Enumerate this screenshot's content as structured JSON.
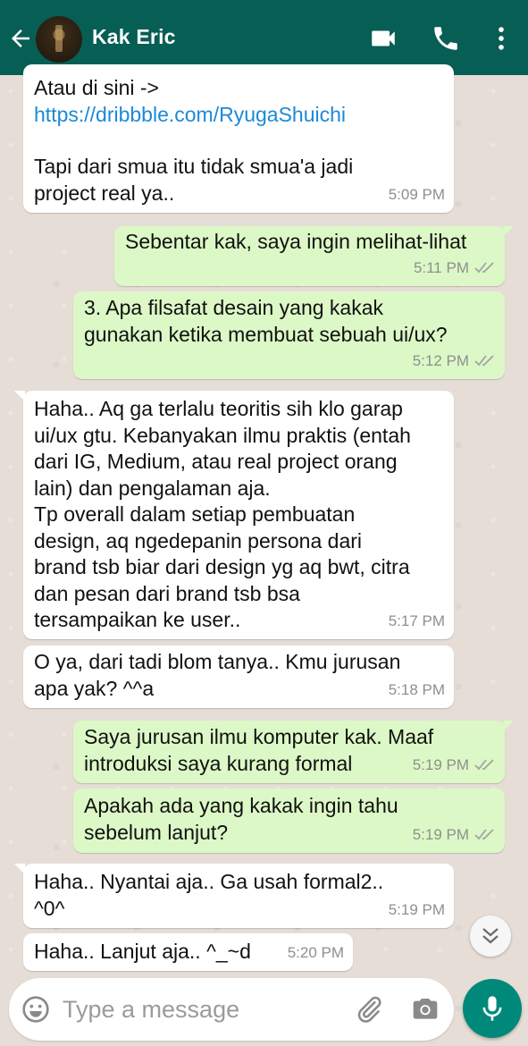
{
  "header": {
    "contact_name": "Kak Eric"
  },
  "icons": {
    "back": "back-arrow-icon",
    "video": "video-call-icon",
    "call": "phone-icon",
    "more": "more-vertical-icon",
    "emoji": "emoji-icon",
    "attach": "paperclip-icon",
    "camera": "camera-icon",
    "mic": "mic-icon",
    "scroll": "chevron-double-down-icon"
  },
  "colors": {
    "header": "#075e54",
    "incoming": "#ffffff",
    "outgoing": "#dcf8c6",
    "mic_button": "#00897b",
    "link": "#1b8ad6"
  },
  "messages": [
    {
      "dir": "in",
      "line1": "Atau di sini ->",
      "link": "https://dribbble.com/RyugaShuichi",
      "text": "Tapi dari smua itu tidak smua'a jadi\nproject real ya..",
      "time": "5:09 PM"
    },
    {
      "dir": "out",
      "text": "Sebentar kak, saya ingin melihat-lihat",
      "time": "5:11 PM"
    },
    {
      "dir": "out",
      "text": "3. Apa filsafat desain yang kakak\ngunakan ketika membuat sebuah ui/ux?",
      "time": "5:12 PM"
    },
    {
      "dir": "in",
      "text": "Haha.. Aq ga terlalu teoritis sih klo garap\nui/ux gtu. Kebanyakan ilmu praktis (entah\ndari IG, Medium, atau real project orang\nlain) dan pengalaman aja.\nTp overall dalam setiap pembuatan\ndesign, aq ngedepanin persona dari\nbrand tsb biar dari design yg aq bwt, citra\ndan pesan dari brand tsb bsa\ntersampaikan ke user..",
      "time": "5:17 PM"
    },
    {
      "dir": "in",
      "text": "O ya, dari tadi blom tanya.. Kmu jurusan\napa yak? ^^a",
      "time": "5:18 PM"
    },
    {
      "dir": "out",
      "text": "Saya jurusan ilmu komputer kak. Maaf\nintroduksi saya kurang formal",
      "time": "5:19 PM"
    },
    {
      "dir": "out",
      "text": "Apakah ada yang kakak ingin tahu\nsebelum lanjut?",
      "time": "5:19 PM"
    },
    {
      "dir": "in",
      "text": "Haha.. Nyantai aja.. Ga usah formal2..\n^0^",
      "time": "5:19 PM"
    },
    {
      "dir": "in",
      "text": "Haha.. Lanjut aja.. ^_~d",
      "time": "5:20 PM"
    }
  ],
  "composer": {
    "placeholder": "Type a message"
  }
}
